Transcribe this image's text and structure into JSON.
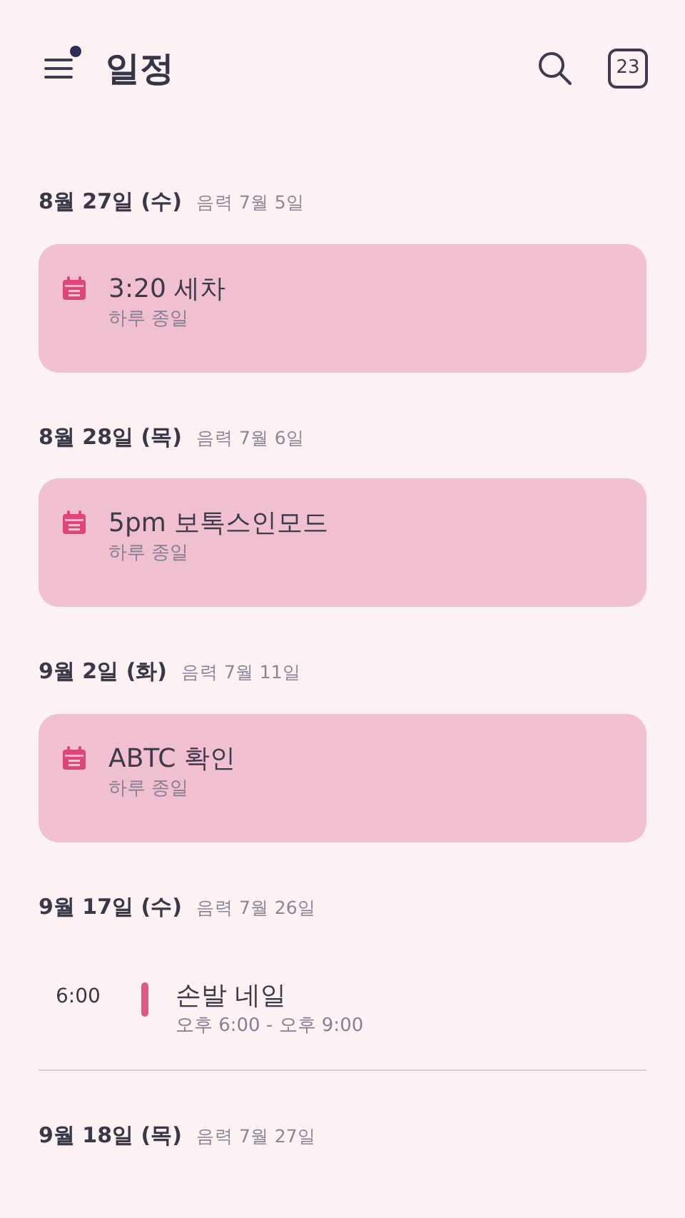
{
  "header": {
    "title": "일정",
    "menu_badge": true,
    "today_number": "23"
  },
  "days": [
    {
      "date": "8월 27일 (수)",
      "lunar": "음력 7월 5일",
      "events": [
        {
          "kind": "allday",
          "title": "3:20 세차",
          "subtitle": "하루 종일",
          "color": "#e0457a"
        }
      ]
    },
    {
      "date": "8월 28일 (목)",
      "lunar": "음력 7월 6일",
      "events": [
        {
          "kind": "allday",
          "title": "5pm 보톡스인모드",
          "subtitle": "하루 종일",
          "color": "#e0457a"
        }
      ]
    },
    {
      "date": "9월 2일 (화)",
      "lunar": "음력 7월 11일",
      "events": [
        {
          "kind": "allday",
          "title": "ABTC 확인",
          "subtitle": "하루 종일",
          "color": "#e0457a"
        }
      ]
    },
    {
      "date": "9월 17일 (수)",
      "lunar": "음력 7월 26일",
      "divider": true,
      "events": [
        {
          "kind": "timed",
          "time": "6:00",
          "title": "손발 네일",
          "subtitle": "오후 6:00 - 오후 9:00",
          "color": "#d95c85"
        }
      ]
    },
    {
      "date": "9월 18일 (목)",
      "lunar": "음력 7월 27일"
    }
  ]
}
